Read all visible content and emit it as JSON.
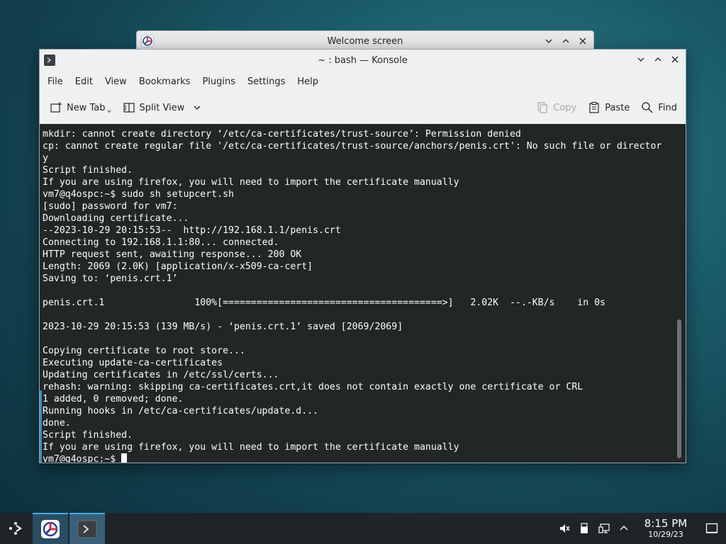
{
  "background_window": {
    "title": "Welcome screen"
  },
  "konsole": {
    "title": "~ : bash — Konsole",
    "menu": [
      "File",
      "Edit",
      "View",
      "Bookmarks",
      "Plugins",
      "Settings",
      "Help"
    ],
    "toolbar": {
      "new_tab": "New Tab",
      "split_view": "Split View",
      "copy": "Copy",
      "paste": "Paste",
      "find": "Find"
    },
    "terminal_lines": [
      "mkdir: cannot create directory ‘/etc/ca-certificates/trust-source’: Permission denied",
      "cp: cannot create regular file '/etc/ca-certificates/trust-source/anchors/penis.crt': No such file or director",
      "y",
      "Script finished.",
      "If you are using firefox, you will need to import the certificate manually",
      "vm7@q4ospc:~$ sudo sh setupcert.sh",
      "[sudo] password for vm7:",
      "Downloading certificate...",
      "--2023-10-29 20:15:53--  http://192.168.1.1/penis.crt",
      "Connecting to 192.168.1.1:80... connected.",
      "HTTP request sent, awaiting response... 200 OK",
      "Length: 2069 (2.0K) [application/x-x509-ca-cert]",
      "Saving to: ‘penis.crt.1’",
      "",
      "penis.crt.1                100%[=======================================>]   2.02K  --.-KB/s    in 0s",
      "",
      "2023-10-29 20:15:53 (139 MB/s) - ‘penis.crt.1’ saved [2069/2069]",
      "",
      "Copying certificate to root store...",
      "Executing update-ca-certificates",
      "Updating certificates in /etc/ssl/certs...",
      "rehash: warning: skipping ca-certificates.crt,it does not contain exactly one certificate or CRL",
      "1 added, 0 removed; done.",
      "Running hooks in /etc/ca-certificates/update.d...",
      "done.",
      "Script finished.",
      "If you are using firefox, you will need to import the certificate manually"
    ],
    "prompt": "vm7@q4ospc:~$ "
  },
  "taskbar": {
    "time": "8:15 PM",
    "date": "10/29/23"
  },
  "colors": {
    "terminal_bg": "#232627",
    "terminal_fg": "#fcfcfc",
    "accent": "#3daee9",
    "taskbar_bg": "#1f2428"
  }
}
